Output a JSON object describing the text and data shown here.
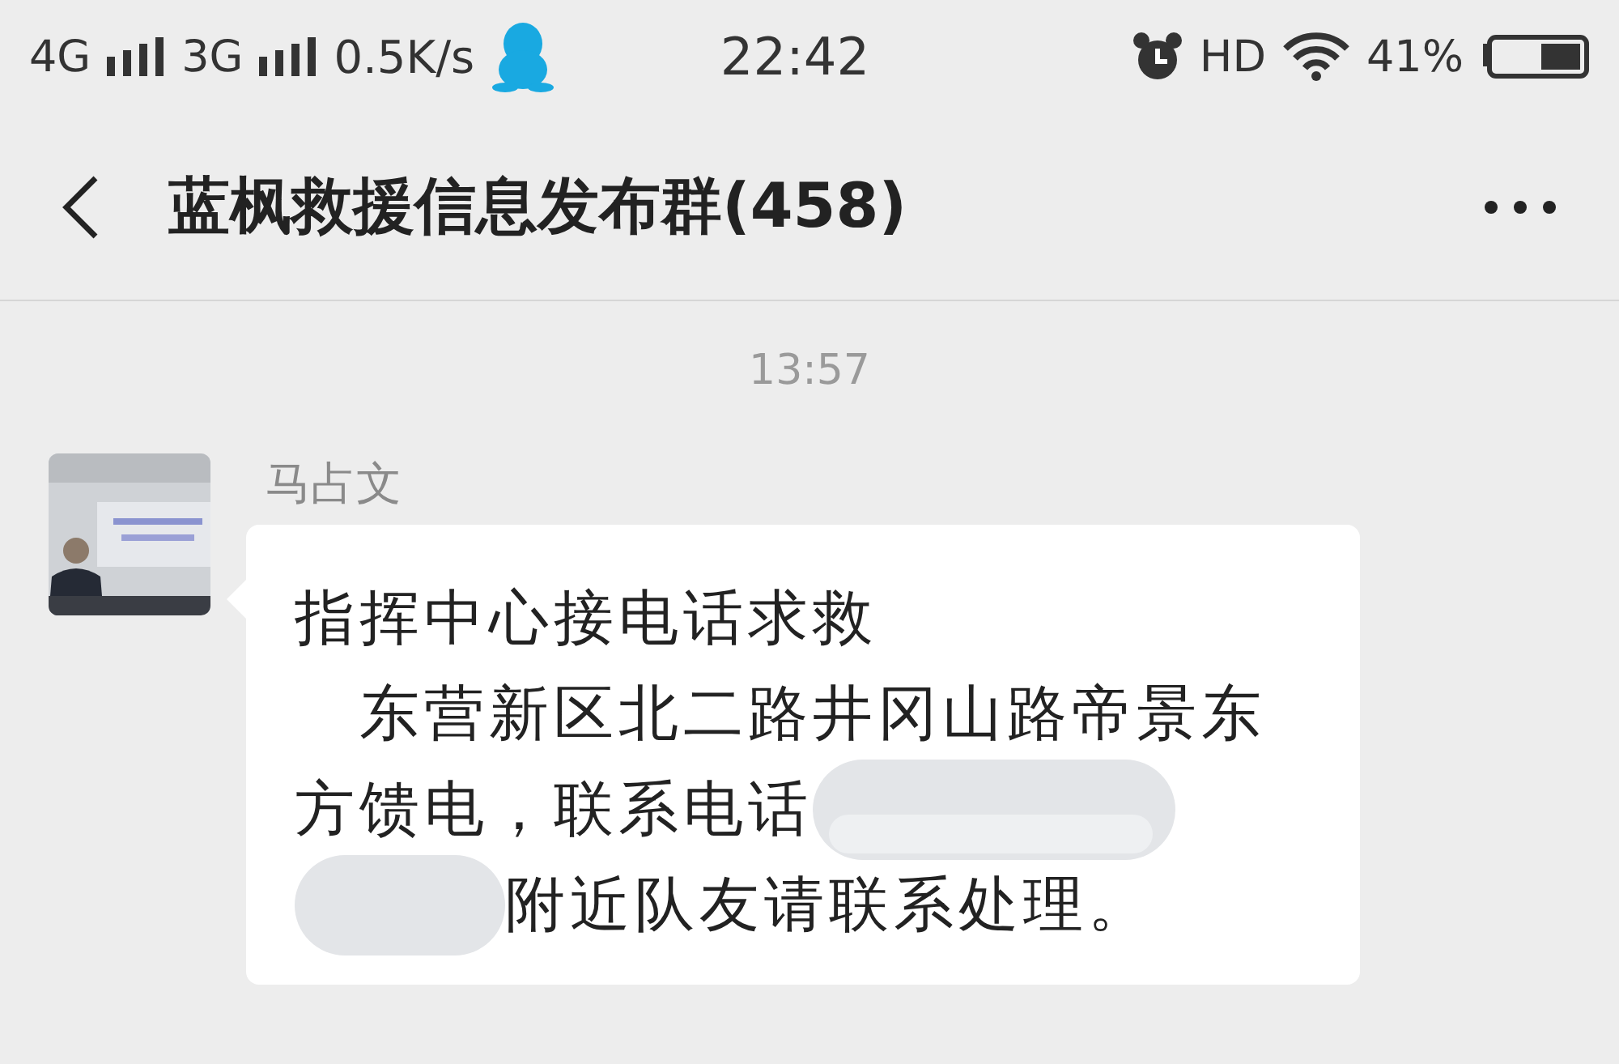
{
  "status_bar": {
    "network_1": "4G",
    "network_2": "3G",
    "speed": "0.5K/s",
    "time": "22:42",
    "hd": "HD",
    "battery": "41%"
  },
  "header": {
    "title": "蓝枫救援信息发布群(458)"
  },
  "messages": [
    {
      "kind": "time",
      "text": "13:57"
    },
    {
      "kind": "message",
      "sender": "马占文",
      "title": "指挥中心接电话求救",
      "body_line": "　东营新区北二路井冈山路帝景东",
      "body_before": "方馈电，联系电话",
      "body_after": "附近队友请联系处理。"
    }
  ]
}
